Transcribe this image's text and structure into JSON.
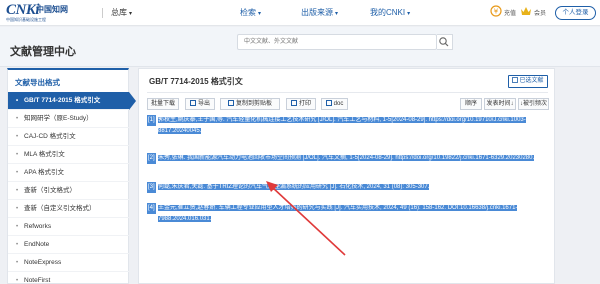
{
  "topbar": {
    "logo_mark": "CNKi",
    "logo_cn": "中国知网",
    "logo_sub": "中国知识基础设施工程",
    "site_switch": "总库",
    "nav": [
      "检索",
      "出版来源",
      "我的CNKI"
    ],
    "icon_labels": [
      "充值",
      "会员"
    ],
    "login_label": "个人登录"
  },
  "header": {
    "title": "文献管理中心",
    "search_placeholder": "中文文献、外文文献"
  },
  "sidebar": {
    "title": "文献导出格式",
    "items": [
      {
        "label": "GB/T 7714-2015 格式引文",
        "active": true
      },
      {
        "label": "知网研学（原E-Study）",
        "active": false
      },
      {
        "label": "CAJ-CD 格式引文",
        "active": false
      },
      {
        "label": "MLA 格式引文",
        "active": false
      },
      {
        "label": "APA 格式引文",
        "active": false
      },
      {
        "label": "查新（引文格式）",
        "active": false
      },
      {
        "label": "查新（自定义引文格式）",
        "active": false
      },
      {
        "label": "Refworks",
        "active": false
      },
      {
        "label": "EndNote",
        "active": false
      },
      {
        "label": "NoteExpress",
        "active": false
      },
      {
        "label": "NoteFirst",
        "active": false
      }
    ]
  },
  "panel": {
    "title": "GB/T 7714-2015 格式引文",
    "exported_label": "已选文献",
    "toolbar": {
      "batch_download": "批量下载",
      "export": "导出",
      "copy": "复制到剪贴板",
      "print": "打印",
      "doc": "doc",
      "sort_order": "顺序",
      "sort_year": "发表时间",
      "sort_citation": "被引频次"
    },
    "citations": [
      {
        "num": "[1]",
        "text": "郭秋生,姚庆泰,王子国,等. 汽车轻量化机械连接工艺技术研究 [J/OL]. 汽车工艺与材料, 1-5[2024-08-29]. https://doi.org/10.19710/J.cnki.1003-8817.20240045."
      },
      {
        "num": "[2]",
        "text": "朱秀,张琳. 我国新能源汽车动力电池回收市场空间预测 [J/OL]. 汽车文摘, 1-5[2024-08-29]. https://doi.org/10.19822/j.cnki.1671-6329.20230280."
      },
      {
        "num": "[3]",
        "text": "何磊,朱庆君,关磊. 基于TRIZ理论的汽车气瓶座漏系统的应用研究 [J]. 石化技术, 2024, 31 (08): 305-307."
      },
      {
        "num": "[4]",
        "text": "王金元,崔立赟,赵春娇. 车辆工程专业应用型人才培养的研究与实践 [J]. 汽车实用技术, 2024, 49 (16): 158-162. DOI:10.16638/j.cnki.1671-7988.2024.016.031."
      }
    ]
  },
  "colors": {
    "brand": "#1f5fa8",
    "selection": "#4a8ad6",
    "annotation_arrow": "#e03a3a"
  },
  "icons": [
    "search-icon",
    "recharge-icon",
    "member-icon",
    "user-icon",
    "download-icon",
    "export-icon",
    "copy-icon",
    "print-icon",
    "doc-icon",
    "tag-icon",
    "sort-arrow-icon"
  ]
}
